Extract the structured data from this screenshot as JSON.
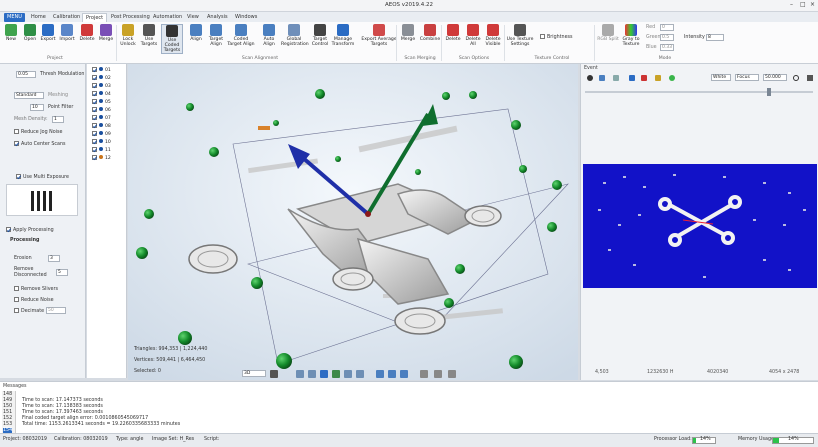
{
  "app": {
    "title": "AEOS v2019.4.22"
  },
  "tabs": [
    "MENU",
    "Home",
    "Calibration",
    "Project",
    "Post Processing",
    "Automation",
    "View",
    "Analysis",
    "Windows"
  ],
  "ribbon": {
    "buttons": [
      "New",
      "Open",
      "Export",
      "Import",
      "Delete",
      "Merge",
      "Lock Unlock",
      "Use Targets",
      "Use Coded Targets",
      "Align",
      "Target Align",
      "Coded Target Align",
      "Auto Align",
      "Global Registration",
      "Target Control",
      "Manage Transform",
      "Export Average Targets",
      "Merge",
      "Combine",
      "Delete",
      "Delete All",
      "Delete Visible",
      "Use Texture Settings",
      "RGB Split",
      "Gray to Texture"
    ],
    "groups": [
      "Project",
      "Scan Alignment",
      "Scan Merging",
      "Scan Options",
      "Texture Control",
      "Mode"
    ],
    "brightness": "Brightness",
    "red": "Red",
    "green": "Green",
    "blue": "Blue",
    "intensity": "Intensity",
    "red_val": "0",
    "green_val": "0.5",
    "blue_val": "0.33",
    "intensity_val": "8"
  },
  "left": {
    "thresh_val": "0.05",
    "thresh": "Thresh Modulation",
    "mode": "Standard",
    "meshing": "Meshing",
    "point_filter_val": "10",
    "point_filter": "Point Filter",
    "mesh_density": "Mesh Density:",
    "mesh_density_val": "1",
    "reduce_jog": "Reduce Jog Noise",
    "auto_center": "Auto Center Scans",
    "multi_exposure": "Use Multi Exposure",
    "apply_processing": "Apply Processing",
    "processing": "Processing",
    "erosion": "Erosion",
    "erosion_val": "3",
    "remove_disc": "Remove Disconnected",
    "remove_disc_val": "5",
    "remove_slivers": "Remove Slivers",
    "reduce_noise": "Reduce Noise",
    "decimate": "Decimate",
    "decimate_val": "50"
  },
  "scans": [
    "01",
    "02",
    "03",
    "04",
    "05",
    "06",
    "07",
    "08",
    "09",
    "10",
    "11",
    "12"
  ],
  "viewport": {
    "triangles": "Triangles: 994,353 | 1,224,440",
    "vertices": "Vertices: 509,441 | 6,464,450",
    "selected": "Selected: 0",
    "view_select": "3D"
  },
  "right": {
    "title": "Event",
    "white": "White",
    "focus": "Focus",
    "val": "50.000",
    "coords": [
      "4,503",
      "1232630 H",
      "4020340",
      "4054 x 2478"
    ]
  },
  "messages": {
    "title": "Messages",
    "lines": [
      "Time to scan: 17.147373 seconds",
      "Time to scan: 17.138383 seconds",
      "Time to scan: 17.397463 seconds",
      "Final coded target align error: 0.0010860545069717",
      "Total time: 1153.2613341 seconds = 19.2260335683333 minutes"
    ],
    "line_nums": [
      "148",
      "149",
      "150",
      "151",
      "152",
      "153",
      "154"
    ]
  },
  "status": {
    "project": "Project: 08032019",
    "calibration": "Calibration: 08032019",
    "type": "Type: angle",
    "image_set": "Image Set: H_Res",
    "script": "Script:",
    "proc_load_label": "Processor Load:",
    "proc_load": "14%",
    "proc_load_frac": 0.14,
    "mem_label": "Memory Usage:",
    "mem": "14%",
    "mem_frac": 0.14
  },
  "colors": {
    "accent": "#2b6cc4",
    "viewport_bg": "#e9f0f7",
    "render_bg": "#1212c8"
  }
}
